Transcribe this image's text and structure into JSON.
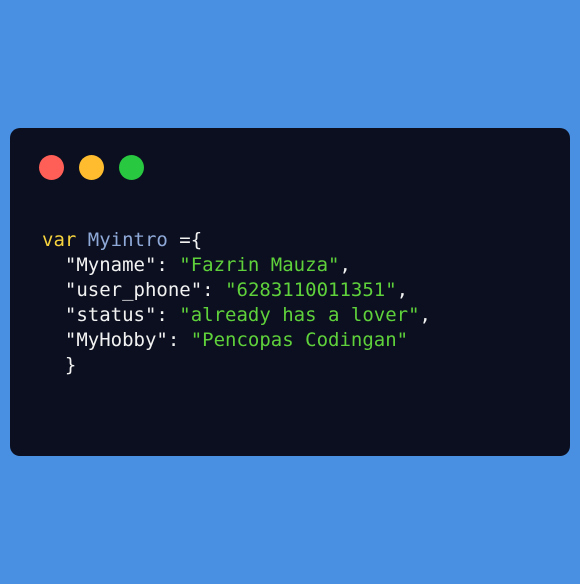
{
  "window": {
    "controls": [
      {
        "name": "close",
        "color": "#ff5f57"
      },
      {
        "name": "minimize",
        "color": "#febc2e"
      },
      {
        "name": "maximize",
        "color": "#28c840"
      }
    ]
  },
  "code": {
    "keyword": "var",
    "variable": "Myintro",
    "assign": " ={",
    "entries": [
      {
        "key": "\"Myname\"",
        "value": "\"Fazrin Mauza\"",
        "trail": ","
      },
      {
        "key": "\"user_phone\"",
        "value": "\"6283110011351\"",
        "trail": ","
      },
      {
        "key": "\"status\"",
        "value": "\"already has a lover\"",
        "trail": ","
      },
      {
        "key": "\"MyHobby\"",
        "value": "\"Pencopas Codingan\"",
        "trail": ""
      }
    ],
    "close": "}"
  },
  "colors": {
    "background": "#4a90e2",
    "window": "#0b0f1f",
    "keyword": "#f6d33e",
    "variable": "#8fa9d8",
    "string": "#5fd13b",
    "text": "#f2f2f2"
  }
}
